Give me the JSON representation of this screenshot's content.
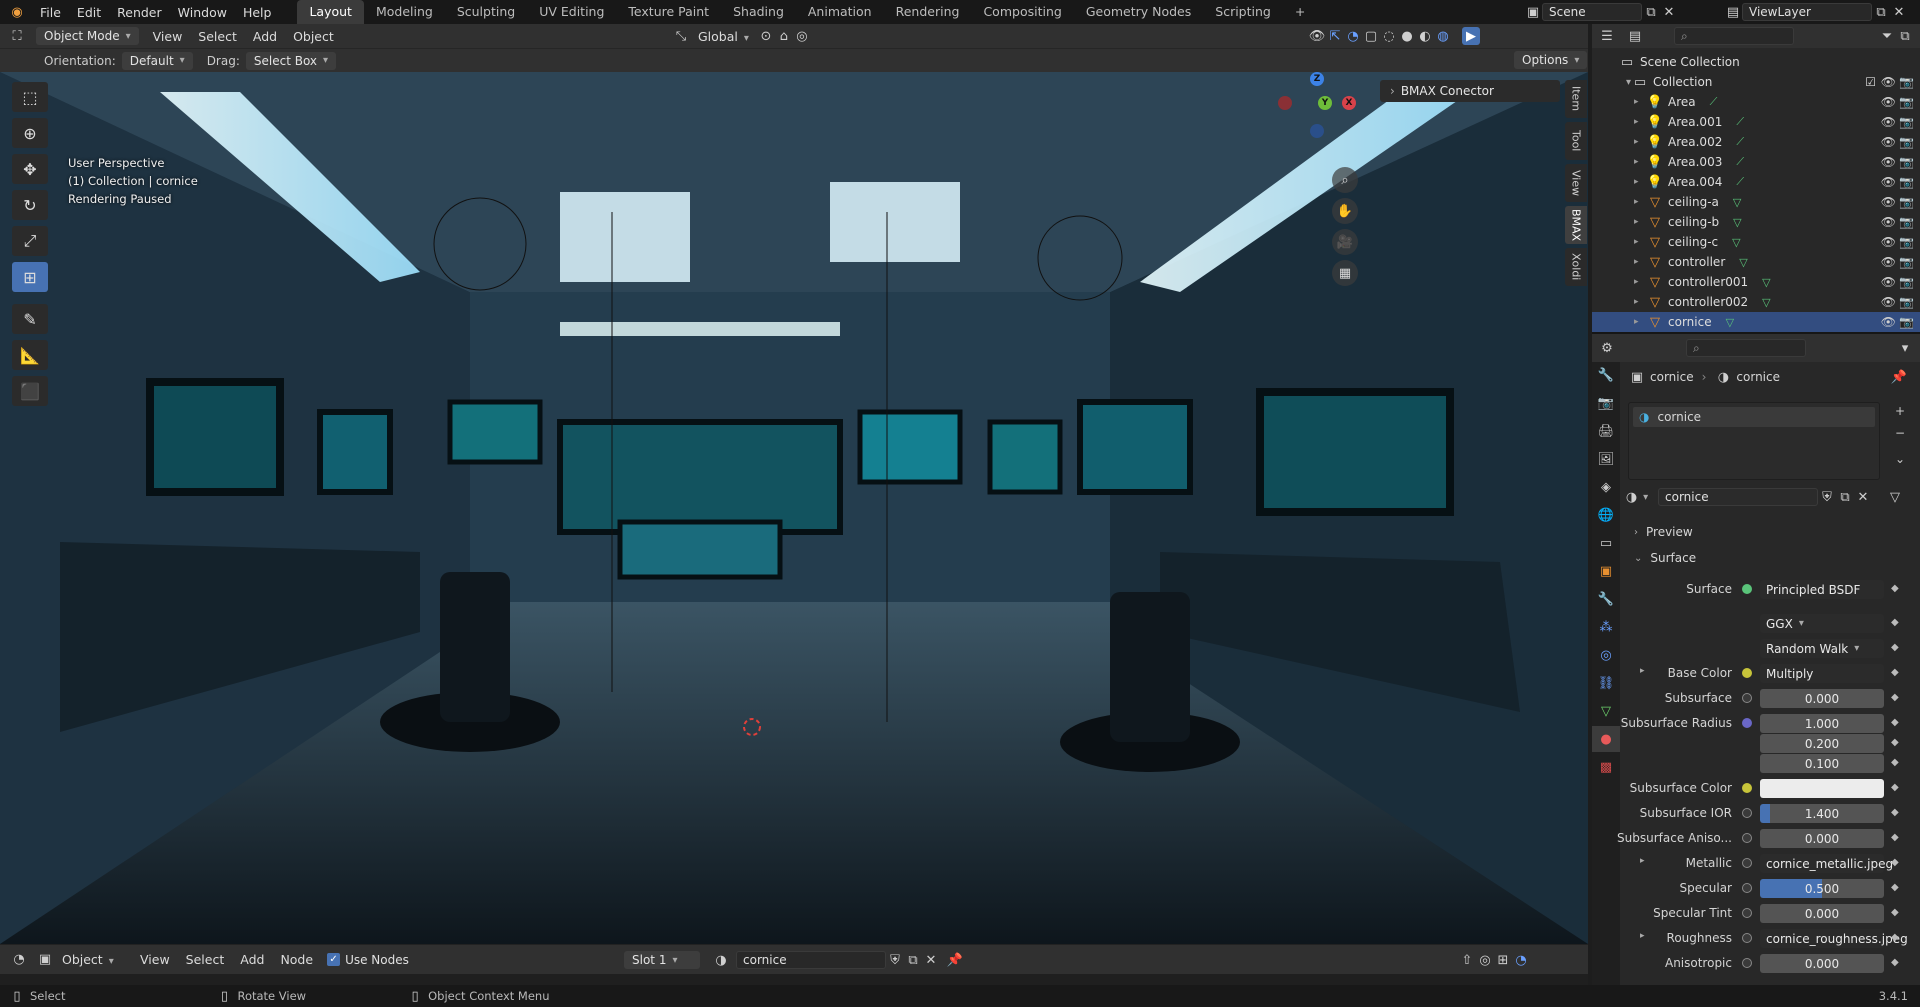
{
  "menu": [
    "File",
    "Edit",
    "Render",
    "Window",
    "Help"
  ],
  "workspaces": [
    "Layout",
    "Modeling",
    "Sculpting",
    "UV Editing",
    "Texture Paint",
    "Shading",
    "Animation",
    "Rendering",
    "Compositing",
    "Geometry Nodes",
    "Scripting",
    "+"
  ],
  "scene_name": "Scene",
  "view_layer": "ViewLayer",
  "viewport_header": {
    "mode": "Object Mode",
    "menus": [
      "View",
      "Select",
      "Add",
      "Object"
    ],
    "orientation_transform": "Global",
    "orientation_label": "Orientation:",
    "orientation_value": "Default",
    "drag_label": "Drag:",
    "drag_value": "Select Box",
    "options": "Options"
  },
  "viewport_overlay": {
    "line1": "User Perspective",
    "line2": "(1) Collection | cornice",
    "line3": "Rendering Paused"
  },
  "sidebar_tabs": [
    "Item",
    "Tool",
    "View",
    "BMAX",
    "Xoldi"
  ],
  "bmax_panel": "BMAX Conector",
  "gizmo_axes": [
    "Z",
    "Y",
    "X"
  ],
  "node_header": {
    "editor": "Object",
    "menus": [
      "View",
      "Select",
      "Add",
      "Node"
    ],
    "use_nodes": "Use Nodes",
    "slot": "Slot 1",
    "material": "cornice"
  },
  "statusbar": {
    "select": "Select",
    "rotate": "Rotate View",
    "context": "Object Context Menu",
    "version": "3.4.1"
  },
  "outliner": {
    "root": "Scene Collection",
    "collection": "Collection",
    "items": [
      {
        "name": "Area",
        "type": "light"
      },
      {
        "name": "Area.001",
        "type": "light"
      },
      {
        "name": "Area.002",
        "type": "light"
      },
      {
        "name": "Area.003",
        "type": "light"
      },
      {
        "name": "Area.004",
        "type": "light"
      },
      {
        "name": "ceiling-a",
        "type": "mesh"
      },
      {
        "name": "ceiling-b",
        "type": "mesh"
      },
      {
        "name": "ceiling-c",
        "type": "mesh"
      },
      {
        "name": "controller",
        "type": "mesh"
      },
      {
        "name": "controller001",
        "type": "mesh"
      },
      {
        "name": "controller002",
        "type": "mesh"
      },
      {
        "name": "cornice",
        "type": "mesh"
      }
    ]
  },
  "properties": {
    "breadcrumb_object": "cornice",
    "breadcrumb_material": "cornice",
    "slot_item": "cornice",
    "material_name": "cornice",
    "panel_preview": "Preview",
    "panel_surface": "Surface",
    "rows": [
      {
        "label": "Surface",
        "value": "Principled BSDF",
        "kind": "link",
        "dot": "g"
      },
      {
        "label": "",
        "value": "GGX",
        "kind": "select"
      },
      {
        "label": "",
        "value": "Random Walk",
        "kind": "select"
      },
      {
        "label": "Base Color",
        "value": "Multiply",
        "kind": "link",
        "dot": "y"
      },
      {
        "label": "Subsurface",
        "value": "0.000",
        "kind": "num",
        "dot": "n"
      },
      {
        "label": "Subsurface Radius",
        "value": "1.000",
        "kind": "num",
        "dot": "p"
      },
      {
        "label": "",
        "value": "0.200",
        "kind": "num"
      },
      {
        "label": "",
        "value": "0.100",
        "kind": "num"
      },
      {
        "label": "Subsurface Color",
        "value": "",
        "kind": "color",
        "dot": "y"
      },
      {
        "label": "Subsurface IOR",
        "value": "1.400",
        "kind": "num",
        "dot": "n"
      },
      {
        "label": "Subsurface Aniso...",
        "value": "0.000",
        "kind": "num",
        "dot": "n"
      },
      {
        "label": "Metallic",
        "value": "cornice_metallic.jpeg",
        "kind": "link",
        "dot": "n"
      },
      {
        "label": "Specular",
        "value": "0.500",
        "kind": "num",
        "dot": "n",
        "fill": 0.5
      },
      {
        "label": "Specular Tint",
        "value": "0.000",
        "kind": "num",
        "dot": "n"
      },
      {
        "label": "Roughness",
        "value": "cornice_roughness.jpeg",
        "kind": "link",
        "dot": "n"
      },
      {
        "label": "Anisotropic",
        "value": "0.000",
        "kind": "num",
        "dot": "n"
      }
    ]
  },
  "colors": {
    "accent": "#4772b3",
    "selection": "#334d80",
    "panel": "#282828",
    "header": "#303030"
  }
}
